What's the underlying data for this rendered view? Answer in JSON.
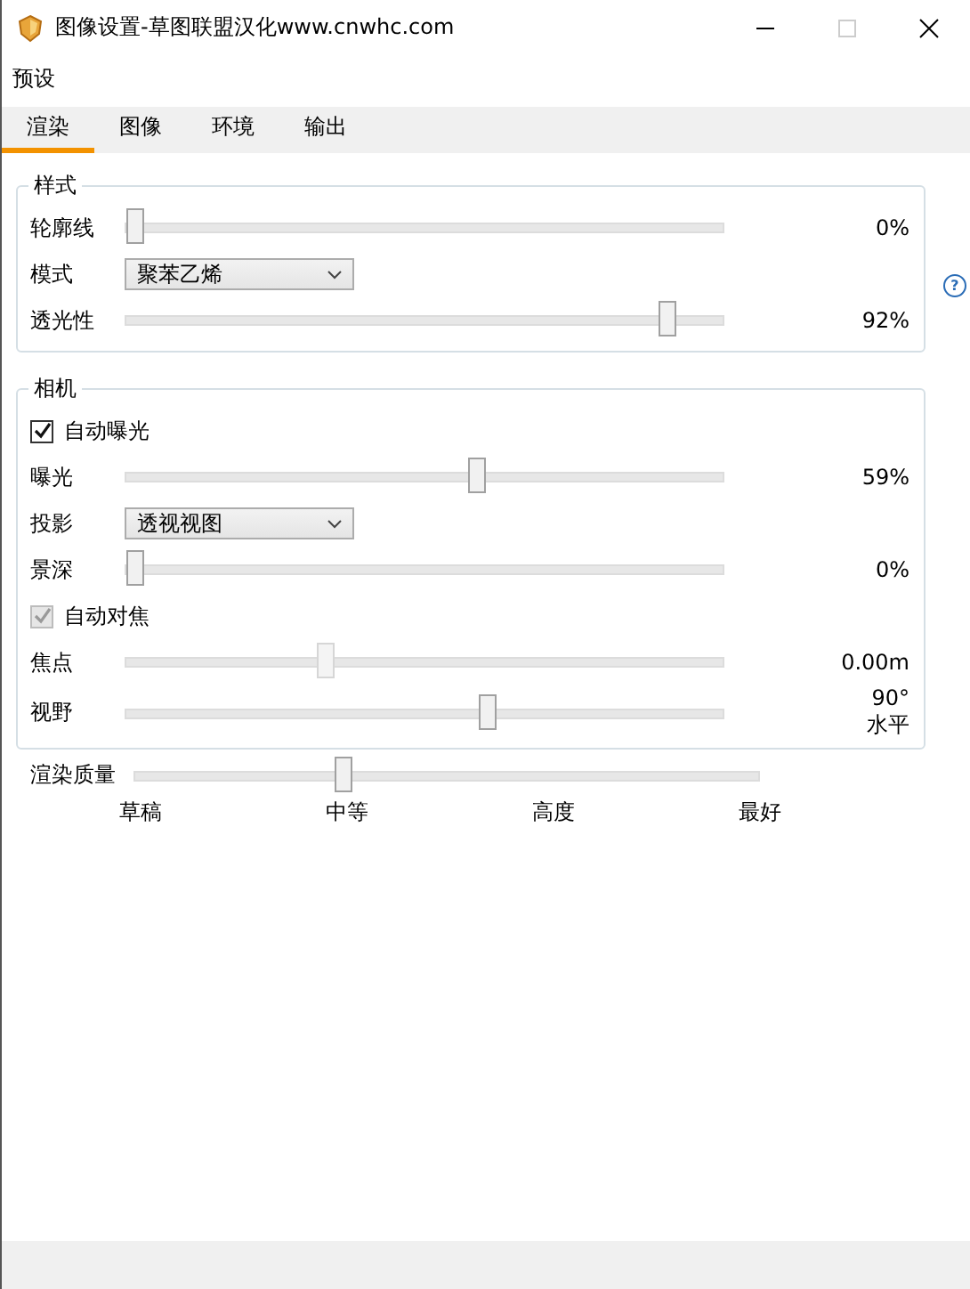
{
  "window": {
    "title": "图像设置-草图联盟汉化www.cnwhc.com"
  },
  "menu": [
    "预设"
  ],
  "tabs": [
    {
      "label": "渲染",
      "selected": true
    },
    {
      "label": "图像",
      "selected": false
    },
    {
      "label": "环境",
      "selected": false
    },
    {
      "label": "输出",
      "selected": false
    }
  ],
  "help": "?",
  "groups": [
    {
      "title": "样式",
      "rows": [
        {
          "kind": "slider",
          "label": "轮廓线",
          "level": 0,
          "reading": "0%",
          "disabled": false
        },
        {
          "kind": "dropdown",
          "label": "模式",
          "value": "聚苯乙烯"
        },
        {
          "kind": "slider",
          "label": "透光性",
          "level": 0.92,
          "reading": "92%",
          "disabled": false
        }
      ]
    },
    {
      "title": "相机",
      "rows": [
        {
          "kind": "checkbox",
          "label": "自动曝光",
          "checked": true,
          "disabled": false
        },
        {
          "kind": "slider",
          "label": "曝光",
          "level": 0.59,
          "reading": "59%",
          "disabled": false
        },
        {
          "kind": "dropdown",
          "label": "投影",
          "value": "透视视图"
        },
        {
          "kind": "slider",
          "label": "景深",
          "level": 0,
          "reading": "0%",
          "disabled": false
        },
        {
          "kind": "checkbox",
          "label": "自动对焦",
          "checked": true,
          "disabled": true
        },
        {
          "kind": "slider",
          "label": "焦点",
          "level": 0.33,
          "reading": "0.00m",
          "disabled": true
        },
        {
          "kind": "slider",
          "label": "视野",
          "level": 0.61,
          "reading": "90°",
          "sub_reading": "水平",
          "disabled": false
        }
      ]
    }
  ],
  "quality": {
    "label": "渲染质量",
    "level": 0.33,
    "ticks": [
      "草稿",
      "中等",
      "高度",
      "最好"
    ]
  }
}
